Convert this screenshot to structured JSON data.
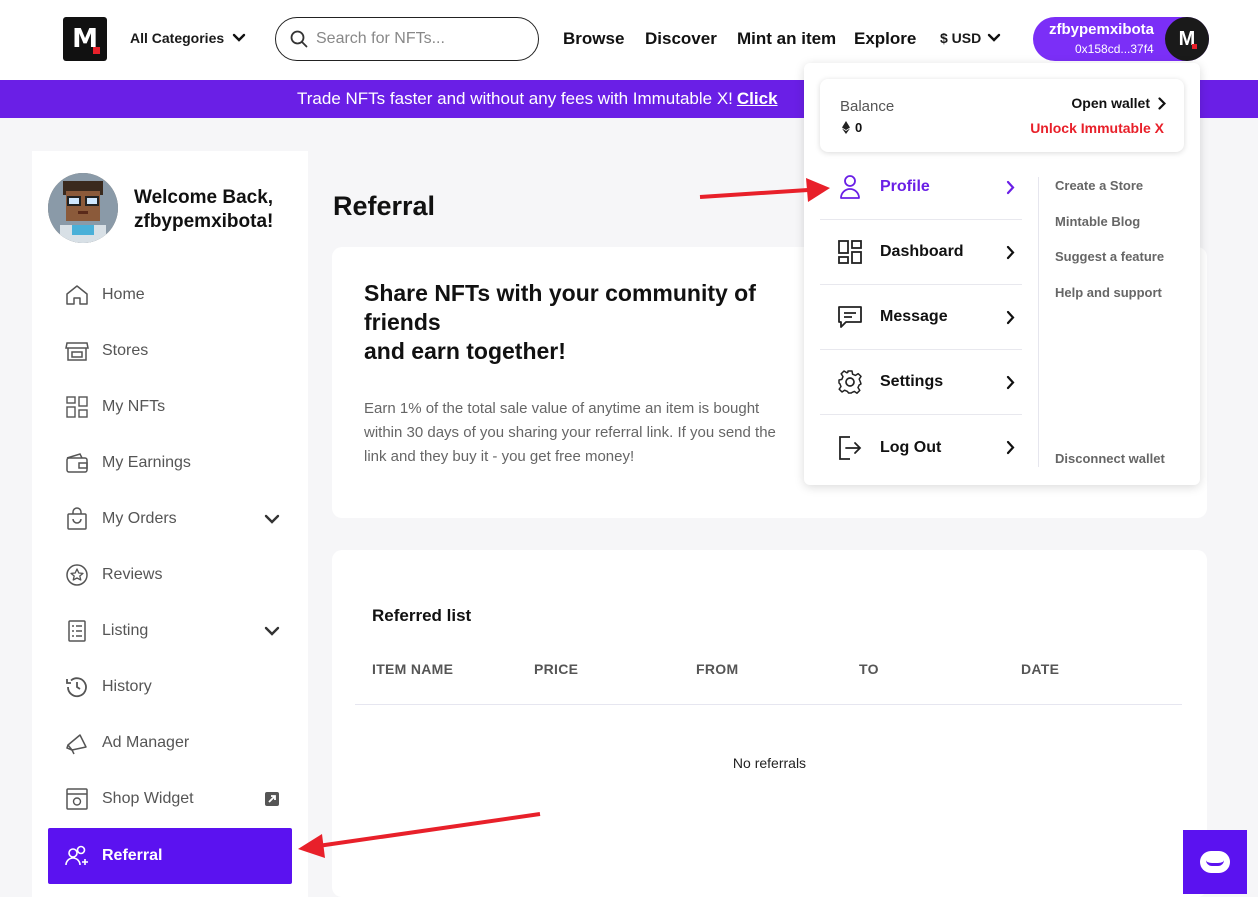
{
  "header": {
    "logo_letter": "M",
    "categories_label": "All Categories",
    "search_placeholder": "Search for NFTs...",
    "nav": [
      "Browse",
      "Discover",
      "Mint an item",
      "Explore"
    ],
    "currency": "$ USD",
    "user_name": "zfbypemxibota",
    "user_address": "0x158cd...37f4"
  },
  "banner": {
    "text": "Trade NFTs faster and without any fees with Immutable X!",
    "link": "Click"
  },
  "sidebar": {
    "welcome_line1": "Welcome Back,",
    "welcome_line2": "zfbypemxibota!",
    "items": [
      {
        "label": "Home",
        "icon": "home-icon"
      },
      {
        "label": "Stores",
        "icon": "store-icon"
      },
      {
        "label": "My NFTs",
        "icon": "grid-icon"
      },
      {
        "label": "My Earnings",
        "icon": "wallet-icon"
      },
      {
        "label": "My Orders",
        "icon": "shopping-bag-icon"
      },
      {
        "label": "Reviews",
        "icon": "star-badge-icon"
      },
      {
        "label": "Listing",
        "icon": "list-icon"
      },
      {
        "label": "History",
        "icon": "history-icon"
      },
      {
        "label": "Ad Manager",
        "icon": "megaphone-icon"
      },
      {
        "label": "Shop Widget",
        "icon": "widget-icon"
      },
      {
        "label": "Referral",
        "icon": "users-plus-icon"
      }
    ]
  },
  "main": {
    "title": "Referral",
    "share_heading_1": "Share NFTs with your community of friends",
    "share_heading_2": "and earn together!",
    "share_text": "Earn 1% of the total sale value of anytime an item is bought within 30 days of you sharing your referral link. If you send the link and they buy it - you get free money!",
    "list_title": "Referred list",
    "columns": [
      "ITEM NAME",
      "PRICE",
      "FROM",
      "TO",
      "DATE"
    ],
    "empty_text": "No referrals"
  },
  "dropdown": {
    "balance_label": "Balance",
    "balance_value": "0",
    "open_wallet": "Open wallet",
    "unlock": "Unlock Immutable X",
    "menu": [
      "Profile",
      "Dashboard",
      "Message",
      "Settings",
      "Log Out"
    ],
    "links": [
      "Create a Store",
      "Mintable Blog",
      "Suggest a feature",
      "Help and support"
    ],
    "disconnect": "Disconnect wallet"
  },
  "colors": {
    "brand_purple": "#6a1fe6",
    "active_purple": "#5b12f0",
    "danger_red": "#e8202a",
    "arrow_red": "#e8202a"
  }
}
